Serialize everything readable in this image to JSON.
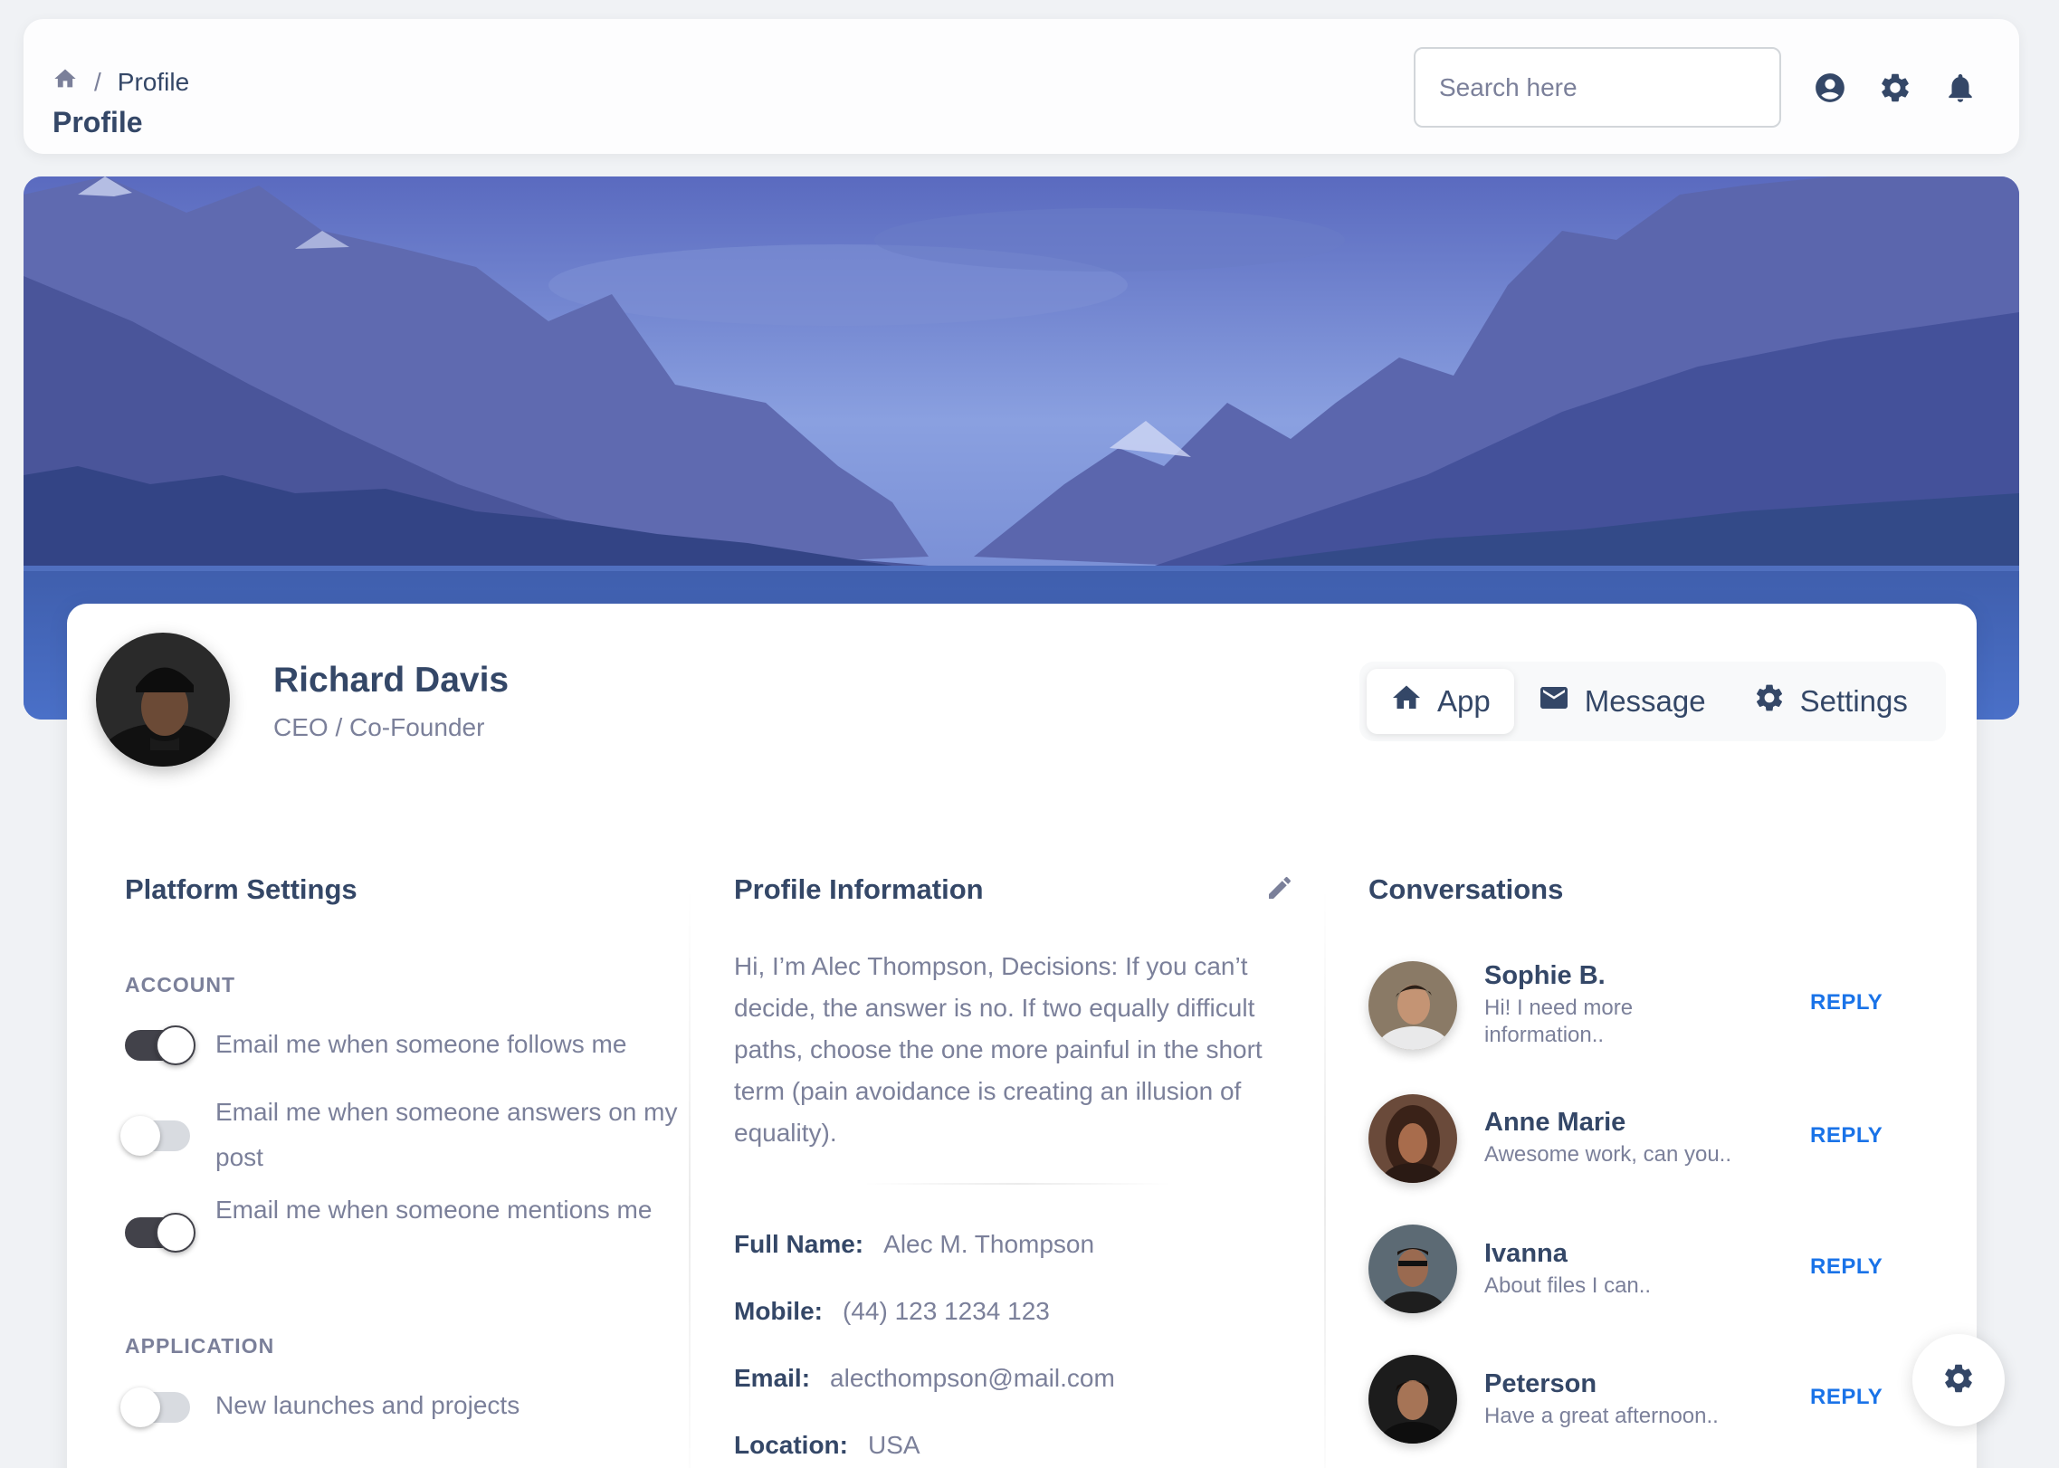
{
  "navbar": {
    "breadcrumb_current": "Profile",
    "breadcrumb_separator": "/",
    "page_title": "Profile",
    "search_placeholder": "Search here",
    "icons": [
      "home-icon",
      "account-circle-icon",
      "settings-icon",
      "notifications-icon"
    ]
  },
  "profile": {
    "name": "Richard Davis",
    "role": "CEO / Co-Founder",
    "tabs": [
      {
        "label": "App",
        "icon": "home-icon",
        "active": true
      },
      {
        "label": "Message",
        "icon": "email-icon",
        "active": false
      },
      {
        "label": "Settings",
        "icon": "settings-icon",
        "active": false
      }
    ]
  },
  "platform_settings": {
    "title": "Platform Settings",
    "account_label": "ACCOUNT",
    "application_label": "APPLICATION",
    "items": [
      {
        "label": "Email me when someone follows me",
        "enabled": true
      },
      {
        "label": "Email me when someone answers on my post",
        "enabled": false
      },
      {
        "label": "Email me when someone mentions me",
        "enabled": true
      },
      {
        "label": "New launches and projects",
        "enabled": false
      }
    ]
  },
  "profile_info": {
    "title": "Profile Information",
    "bio": "Hi, I’m Alec Thompson, Decisions: If you can’t decide, the answer is no. If two equally difficult paths, choose the one more painful in the short term (pain avoidance is creating an illusion of equality).",
    "fields": [
      {
        "key": "Full Name:",
        "value": "Alec M. Thompson"
      },
      {
        "key": "Mobile:",
        "value": "(44) 123 1234 123"
      },
      {
        "key": "Email:",
        "value": "alecthompson@mail.com"
      },
      {
        "key": "Location:",
        "value": "USA"
      }
    ]
  },
  "conversations": {
    "title": "Conversations",
    "reply_label": "REPLY",
    "items": [
      {
        "name": "Sophie B.",
        "message": "Hi! I need more information.."
      },
      {
        "name": "Anne Marie",
        "message": "Awesome work, can you.."
      },
      {
        "name": "Ivanna",
        "message": "About files I can.."
      },
      {
        "name": "Peterson",
        "message": "Have a great afternoon.."
      }
    ]
  },
  "colors": {
    "text_dark": "#344767",
    "text_muted": "#7b809a",
    "link_blue": "#1a73e8",
    "toggle_on": "#42424a"
  }
}
